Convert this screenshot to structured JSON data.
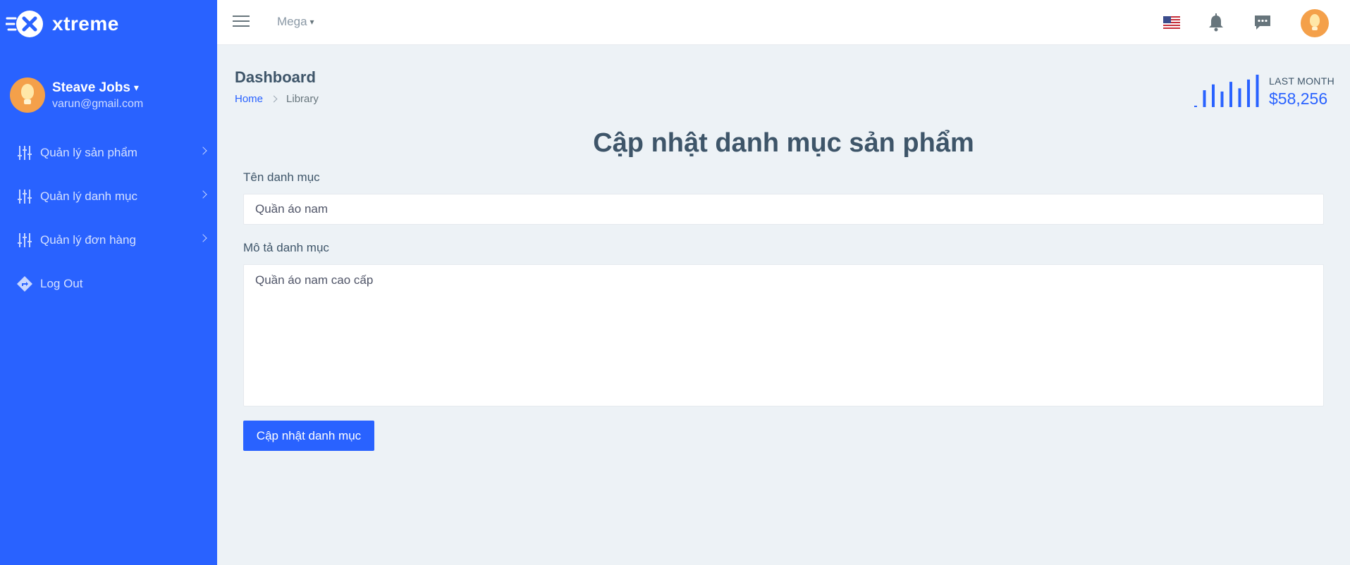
{
  "brand": {
    "name": "xtreme",
    "logo_icon": "x-rocket-logo"
  },
  "sidebar": {
    "user": {
      "name": "Steave Jobs",
      "email": "varun@gmail.com"
    },
    "items": [
      {
        "label": "Quản lý sản phẩm",
        "icon": "sliders-icon",
        "has_arrow": true
      },
      {
        "label": "Quản lý danh mục",
        "icon": "sliders-icon",
        "has_arrow": true
      },
      {
        "label": "Quản lý đơn hàng",
        "icon": "sliders-icon",
        "has_arrow": true
      },
      {
        "label": "Log Out",
        "icon": "directions-icon",
        "has_arrow": false
      }
    ]
  },
  "topbar": {
    "mega_label": "Mega",
    "icons": [
      "menu-icon",
      "us-flag-icon",
      "bell-icon",
      "chat-icon",
      "avatar"
    ]
  },
  "header": {
    "title": "Dashboard",
    "breadcrumb": {
      "home": "Home",
      "current": "Library"
    },
    "stat": {
      "label": "LAST MONTH",
      "value": "$58,256"
    },
    "sparkline_bars": [
      0.04,
      0.52,
      0.7,
      0.48,
      0.78,
      0.58,
      0.85,
      1.0
    ],
    "accent": "#2962ff"
  },
  "form": {
    "title": "Cập nhật danh mục sản phẩm",
    "name_label": "Tên danh mục",
    "name_value": "Quần áo nam",
    "desc_label": "Mô tả danh mục",
    "desc_value": "Quần áo nam cao cấp",
    "submit_label": "Cập nhật danh mục"
  }
}
